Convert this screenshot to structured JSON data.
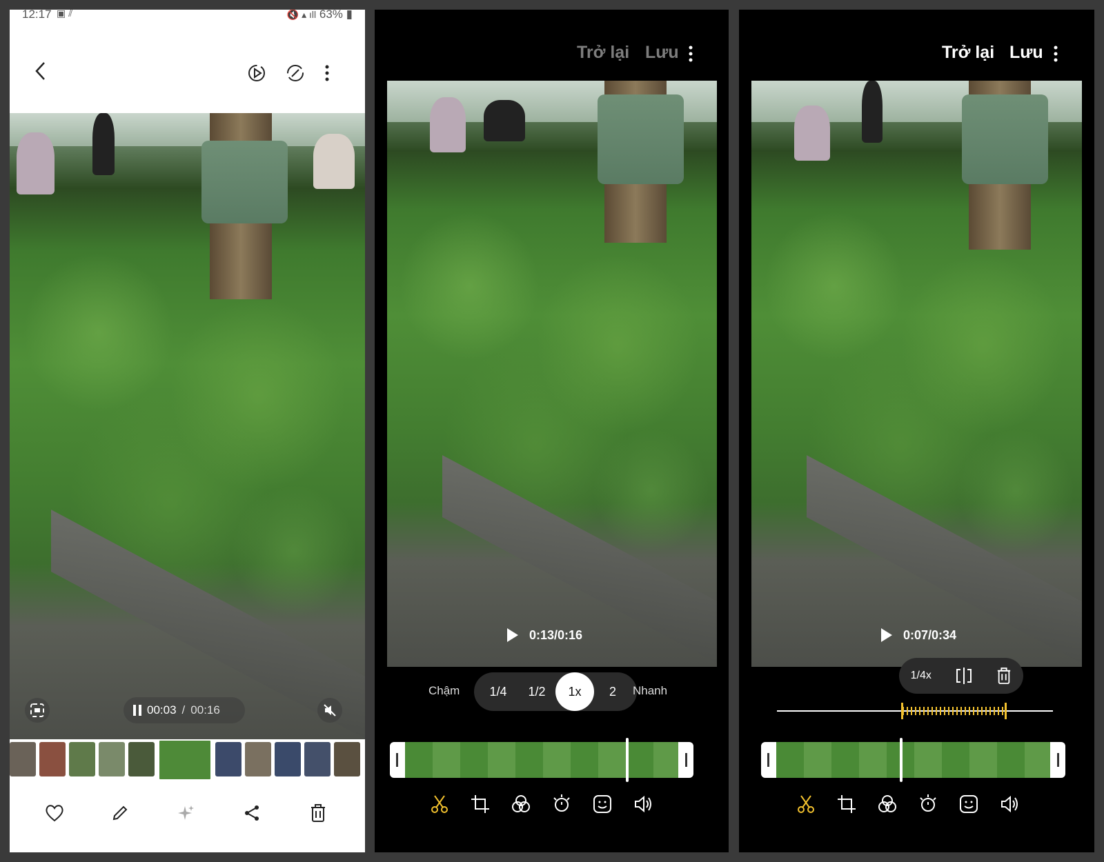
{
  "screen1": {
    "status": {
      "time": "12:17",
      "battery": "63%"
    },
    "player": {
      "current": "00:03",
      "separator": "/",
      "duration": "00:16"
    },
    "icons": {
      "back": "back-arrow-icon",
      "motion": "motion-play-icon",
      "rotate": "rotate-icon",
      "more": "more-vert-icon",
      "capture": "screen-capture-icon",
      "mute": "mute-icon",
      "pause": "pause-icon",
      "favorite": "heart-icon",
      "edit": "pencil-icon",
      "effects": "sparkle-icon",
      "share": "share-icon",
      "delete": "trash-icon"
    }
  },
  "screen2": {
    "header": {
      "back": "Trở lại",
      "save": "Lưu"
    },
    "player": {
      "time": "0:13/0:16"
    },
    "speed": {
      "slow_label": "Chậm",
      "fast_label": "Nhanh",
      "options": [
        "1/4",
        "1/2",
        "1x",
        "2"
      ],
      "selected": "1x"
    }
  },
  "screen3": {
    "header": {
      "back": "Trở lại",
      "save": "Lưu"
    },
    "player": {
      "time": "0:07/0:34"
    },
    "segment_popup": {
      "speed": "1/4x"
    }
  },
  "colors": {
    "accent": "#f2c12e",
    "dim_text": "#7d7d7d",
    "white": "#ffffff"
  }
}
